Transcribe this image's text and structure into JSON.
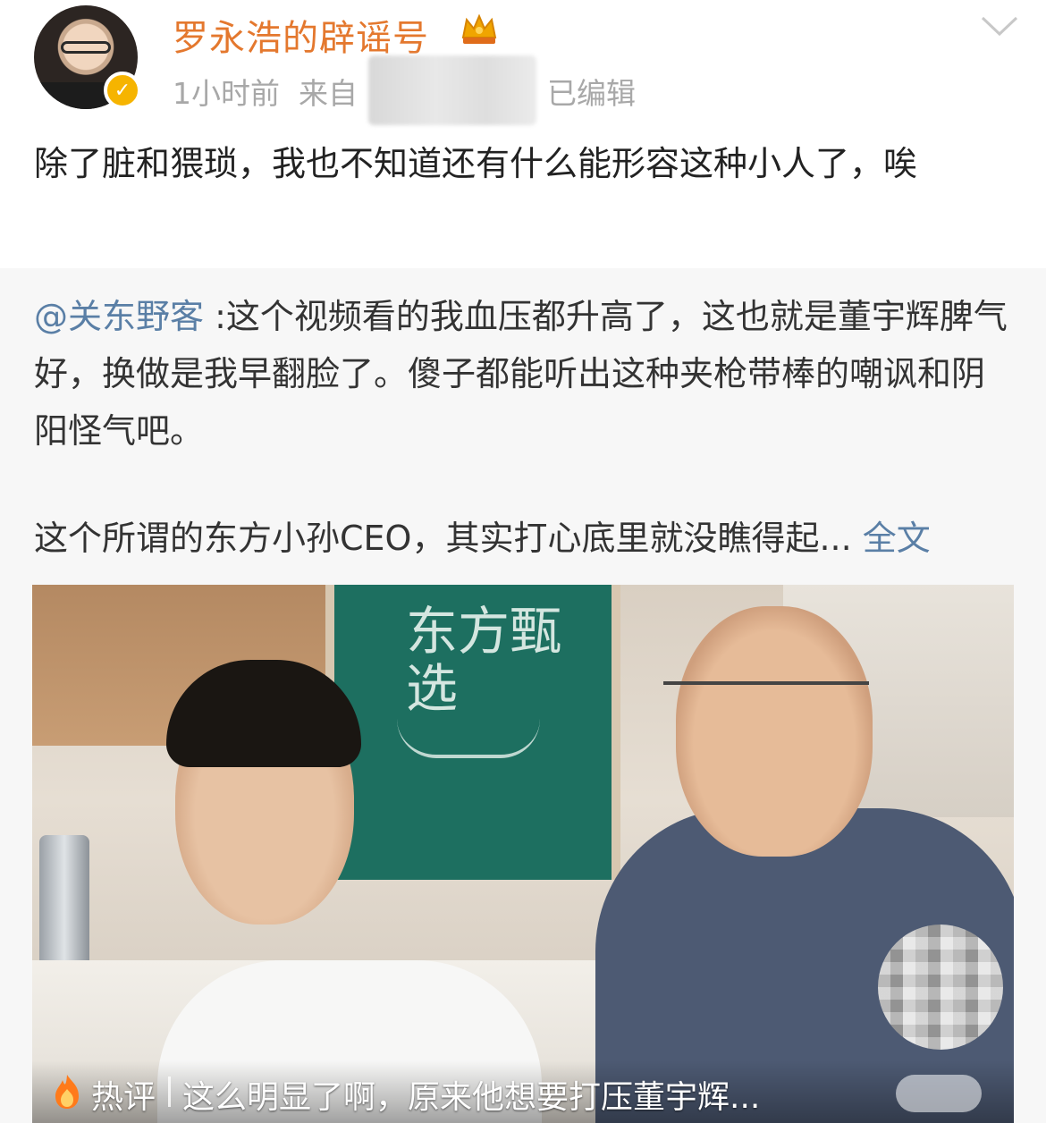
{
  "post": {
    "username": "罗永浩的辟谣号",
    "time": "1小时前",
    "from_label": "来自",
    "edited": "已编辑",
    "text": "除了脏和猥琐，我也不知道还有什么能形容这种小人了，唉"
  },
  "repost": {
    "mention": "@关东野客",
    "text": " :这个视频看的我血压都升高了，这也就是董宇辉脾气好，换做是我早翻脸了。傻子都能听出这种夹枪带棒的嘲讽和阴阳怪气吧。",
    "summary": "这个所谓的东方小孙CEO，其实打心底里就没瞧得起...",
    "full_text_link": "全文",
    "video_board_text": "东方甄选"
  },
  "hot_comment": {
    "label": "热评",
    "text": "这么明显了啊，原来他想要打压董宇辉..."
  },
  "colors": {
    "username": "#e4782e",
    "link": "#5a7fa6",
    "meta": "#a8a8a8",
    "verified": "#f6b400"
  },
  "icons": {
    "verified_badge": "verified-badge-icon",
    "crown": "crown-icon",
    "chevron": "chevron-down-icon",
    "fire": "fire-icon"
  }
}
